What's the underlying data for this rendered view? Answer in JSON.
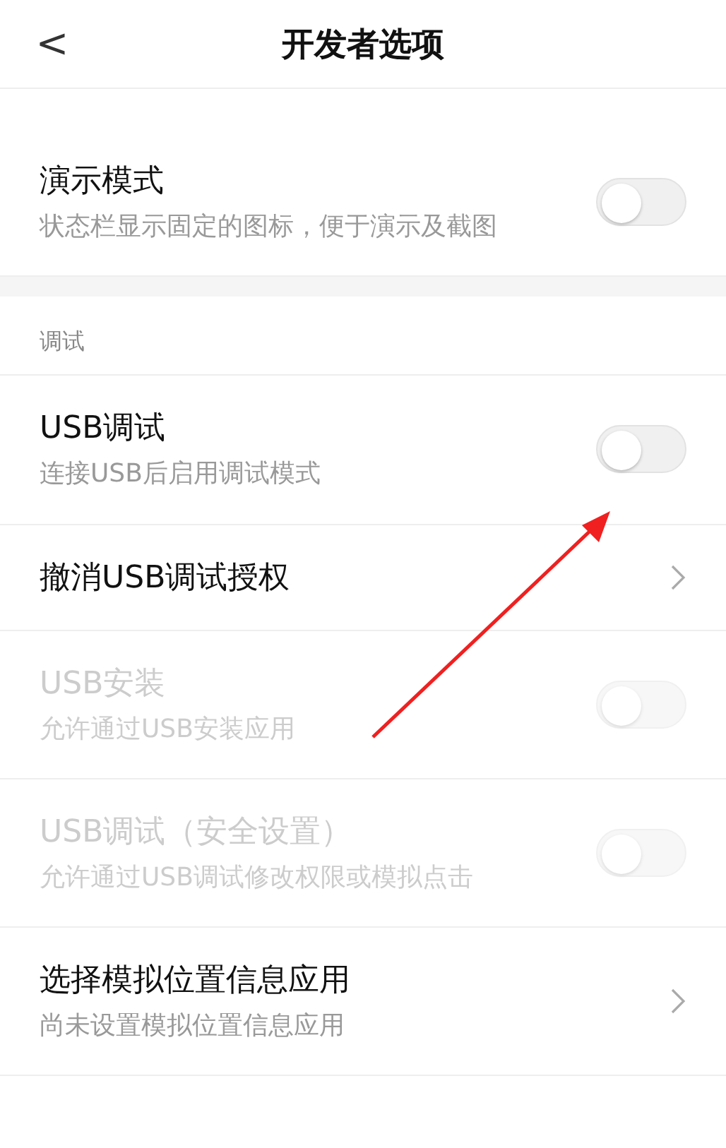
{
  "header": {
    "title": "开发者选项",
    "back": "<"
  },
  "groups": [
    {
      "items": [
        {
          "kind": "toggle",
          "title": "演示模式",
          "subtitle": "状态栏显示固定的图标，便于演示及截图",
          "on": false,
          "disabled": false
        }
      ]
    },
    {
      "section": "调试",
      "items": [
        {
          "kind": "toggle",
          "title": "USB调试",
          "subtitle": "连接USB后启用调试模式",
          "on": false,
          "disabled": false
        },
        {
          "kind": "link",
          "title": "撤消USB调试授权"
        },
        {
          "kind": "toggle",
          "title": "USB安装",
          "subtitle": "允许通过USB安装应用",
          "on": false,
          "disabled": true
        },
        {
          "kind": "toggle",
          "title": "USB调试（安全设置）",
          "subtitle": "允许通过USB调试修改权限或模拟点击",
          "on": false,
          "disabled": true
        },
        {
          "kind": "link",
          "title": "选择模拟位置信息应用",
          "subtitle": "尚未设置模拟位置信息应用"
        }
      ]
    }
  ]
}
